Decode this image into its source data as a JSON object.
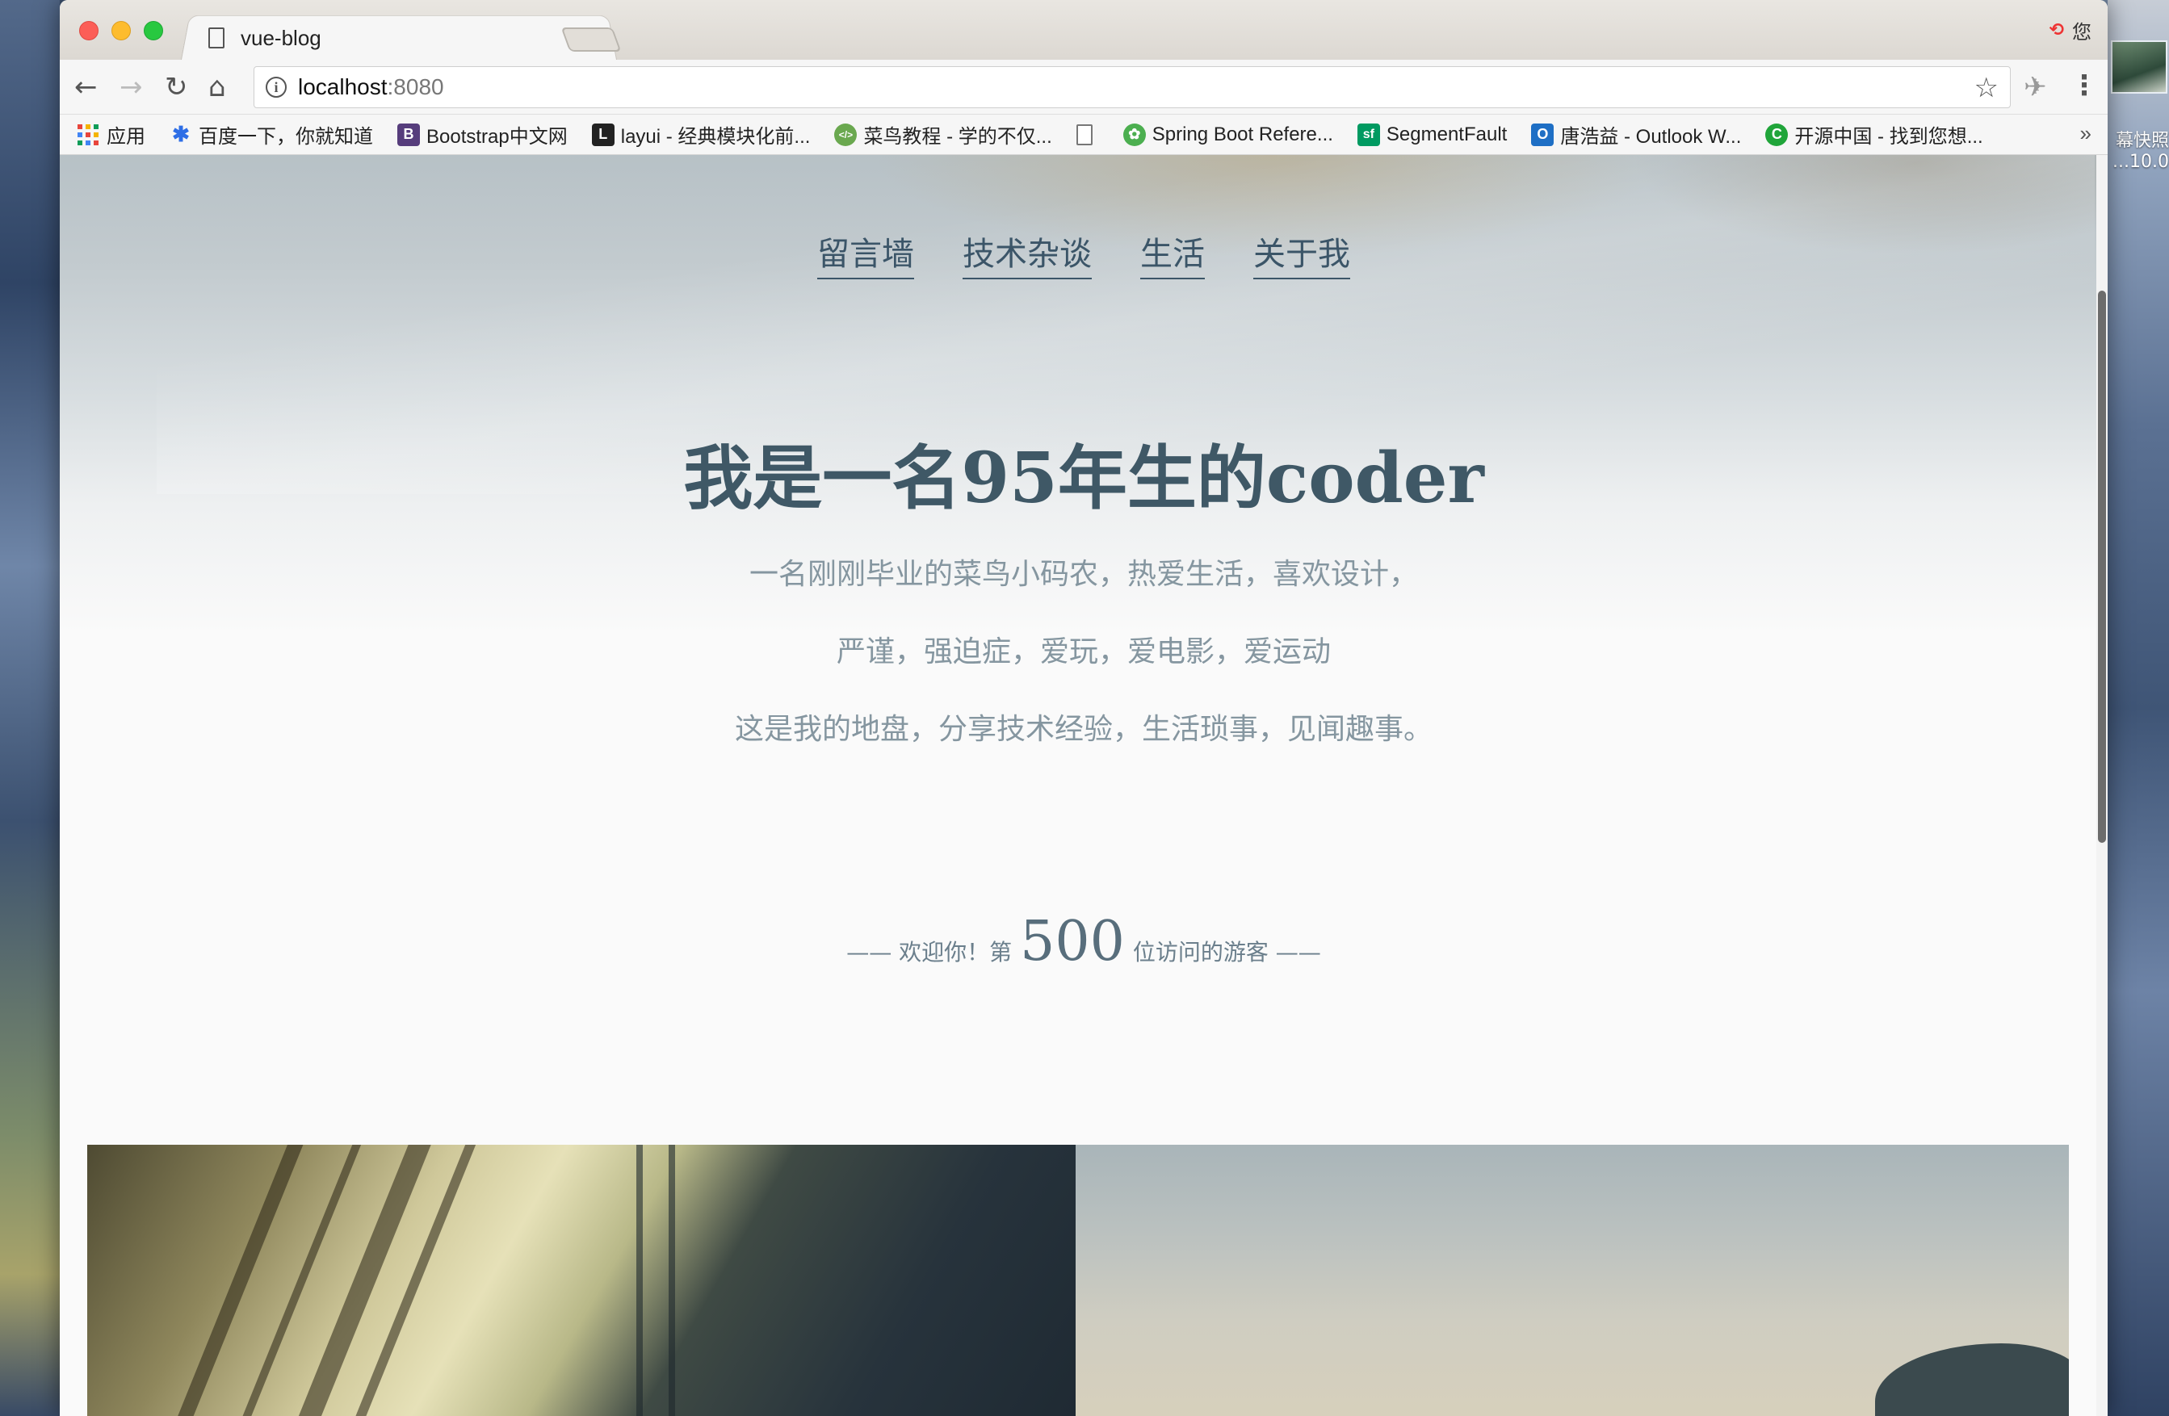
{
  "desktop": {
    "right_label_1": "幕快照",
    "right_label_2": "...10.0"
  },
  "browser": {
    "tab_title": "vue-blog",
    "tab_close": "×",
    "profile_label": "您",
    "url_host": "localhost",
    "url_port": ":8080",
    "bookmarks": [
      {
        "label": "应用",
        "icon": "apps-grid-icon",
        "color": "#e8453c"
      },
      {
        "label": "百度一下，你就知道",
        "icon": "baidu-paw-icon",
        "color": "#2e6ee6"
      },
      {
        "label": "Bootstrap中文网",
        "icon": "bootstrap-b-icon",
        "color": "#563d7c",
        "glyph": "B"
      },
      {
        "label": "layui - 经典模块化前...",
        "icon": "layui-icon",
        "color": "#222222",
        "glyph": "L"
      },
      {
        "label": "菜鸟教程 - 学的不仅...",
        "icon": "runoob-icon",
        "color": "#6aa84f",
        "glyph": "</>"
      },
      {
        "label": "",
        "icon": "page-icon",
        "color": "#777777",
        "glyph": ""
      },
      {
        "label": "Spring Boot Refere...",
        "icon": "spring-leaf-icon",
        "color": "#4caf50",
        "glyph": "✿"
      },
      {
        "label": "SegmentFault",
        "icon": "segmentfault-icon",
        "color": "#009a61",
        "glyph": "sf"
      },
      {
        "label": "唐浩益 - Outlook W...",
        "icon": "outlook-icon",
        "color": "#1e6fc5",
        "glyph": "O"
      },
      {
        "label": "开源中国 - 找到您想...",
        "icon": "oschina-icon",
        "color": "#20a53a",
        "glyph": "C"
      }
    ],
    "more_label": "»"
  },
  "page": {
    "nav": [
      "留言墙",
      "技术杂谈",
      "生活",
      "关于我"
    ],
    "title": "我是一名95年生的coder",
    "desc": [
      "一名刚刚毕业的菜鸟小码农，热爱生活，喜欢设计，",
      "严谨，强迫症，爱玩，爱电影，爱运动",
      "这是我的地盘，分享技术经验，生活琐事，见闻趣事。"
    ],
    "visitor": {
      "prefix": "—— 欢迎你！第",
      "count": "500",
      "suffix": "位访问的游客 ——"
    }
  }
}
